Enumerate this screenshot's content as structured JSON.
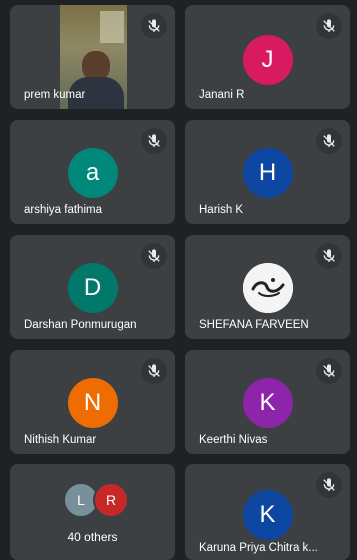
{
  "participants": [
    {
      "name": "prem kumar",
      "type": "video"
    },
    {
      "name": "Janani R",
      "initial": "J",
      "color": "#d81b60"
    },
    {
      "name": "arshiya fathima",
      "initial": "a",
      "color": "#00897b"
    },
    {
      "name": "Harish K",
      "initial": "H",
      "color": "#0d47a1"
    },
    {
      "name": "Darshan Ponmurugan",
      "initial": "D",
      "color": "#00796b"
    },
    {
      "name": "SHEFANA FARVEEN",
      "type": "image"
    },
    {
      "name": "Nithish Kumar",
      "initial": "N",
      "color": "#ef6c00"
    },
    {
      "name": "Keerthi Nivas",
      "initial": "K",
      "color": "#8e24aa"
    },
    {
      "name": "Karuna Priya Chitra k...",
      "initial": "K",
      "color": "#0d47a1"
    }
  ],
  "others": {
    "label": "40 others",
    "avatars": [
      {
        "initial": "L",
        "color": "#78909c"
      },
      {
        "initial": "R",
        "color": "#c62828"
      }
    ]
  },
  "icons": {
    "mic": "mic-off-icon"
  }
}
